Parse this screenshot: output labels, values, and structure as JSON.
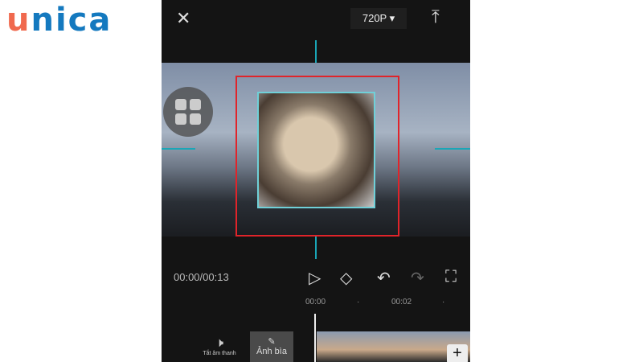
{
  "logo": {
    "text": "unica",
    "colors": {
      "u": "#f0694e",
      "rest": "#1479bf"
    }
  },
  "top": {
    "resolution": "720P",
    "close_icon": "close-icon",
    "export_icon": "upload-icon"
  },
  "player": {
    "time": "00:00/00:13"
  },
  "timeline": {
    "ticks": [
      "00:00",
      "00:02"
    ],
    "mute_label": "Tắt âm thanh",
    "cover_label": "Ảnh bìa",
    "add": "+"
  },
  "colors": {
    "guide": "#1aa6b7",
    "selection": "#e0242a"
  }
}
